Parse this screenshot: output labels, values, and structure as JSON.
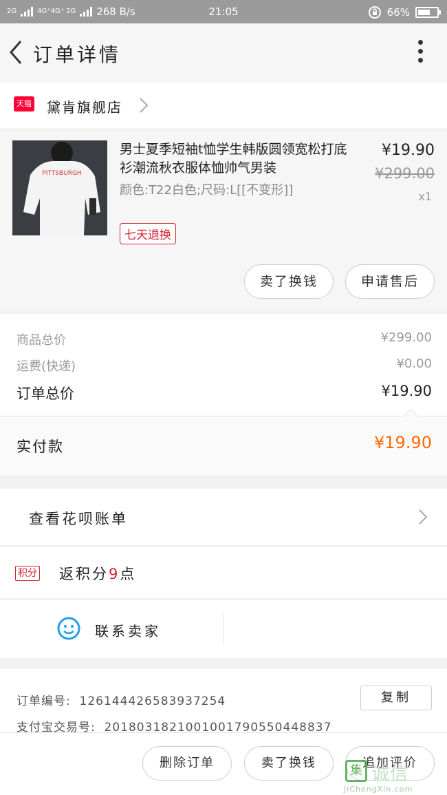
{
  "status_bar": {
    "net1": "2G",
    "net2": "4G⁺4G⁺ 2G",
    "speed": "268 B/s",
    "time": "21:05",
    "battery": "66%",
    "battery_level": 0.66
  },
  "header": {
    "title": "订单详情"
  },
  "store": {
    "badge": "天猫",
    "name": "黛肯旗舰店"
  },
  "product": {
    "title": "男士夏季短袖t恤学生韩版圆领宽松打底衫潮流秋衣服体恤帅气男装",
    "spec": "颜色:T22白色;尺码:L[[不变形]]",
    "tag": "七天退换",
    "price": "¥19.90",
    "original_price": "¥299.00",
    "quantity": "x1",
    "image_text": "PITTSBURGH",
    "btn_sell": "卖了换钱",
    "btn_after_sale": "申请售后"
  },
  "summary": {
    "goods_total_label": "商品总价",
    "goods_total": "¥299.00",
    "shipping_label": "运费(快递)",
    "shipping": "¥0.00",
    "order_total_label": "订单总价",
    "order_total": "¥19.90",
    "paid_label": "实付款",
    "paid": "¥19.90"
  },
  "huabei": {
    "label": "查看花呗账单"
  },
  "points": {
    "badge": "积分",
    "prefix": "返积分",
    "value": "9",
    "suffix": "点"
  },
  "contact": {
    "label": "联系卖家"
  },
  "order_info": {
    "order_no_label": "订单编号:",
    "order_no": "1261444265839372​54",
    "alipay_label": "支付宝交易号:",
    "alipay_no": "2018031821001001790550448837",
    "copy": "复制"
  },
  "bottom": {
    "delete": "删除订单",
    "sell": "卖了换钱",
    "review": "追加评价"
  },
  "watermark": {
    "logo": "集",
    "cn": "诚信",
    "en": "JiChengXin.com"
  },
  "colors": {
    "accent": "#ff6a00",
    "tmall_red": "#ff0036",
    "tag_red": "#d4202e",
    "status_bar": "#9b9b9b"
  }
}
